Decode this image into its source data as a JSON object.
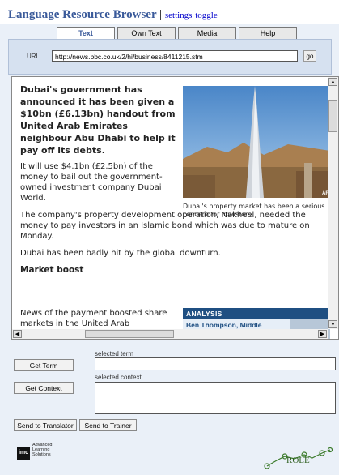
{
  "header": {
    "title": "Language Resource Browser",
    "separator": "|",
    "links": [
      "settings",
      "toggle"
    ]
  },
  "tabs": [
    {
      "label": "Text",
      "active": true
    },
    {
      "label": "Own Text",
      "active": false
    },
    {
      "label": "Media",
      "active": false
    },
    {
      "label": "Help",
      "active": false
    }
  ],
  "url_bar": {
    "label": "URL",
    "value": "http://news.bbc.co.uk/2/hi/business/8411215.stm",
    "go_label": "go"
  },
  "article": {
    "headline": "Dubai's government has announced it has been given a $10bn (£6.13bn) handout from United Arab Emirates neighbour Abu Dhabi to help it pay off its debts.",
    "p1": "It will use $4.1bn (£2.5bn) of the money to bail out the government-owned investment company Dubai World.",
    "p2": "The company's property development operation, Nakheel, needed the money to pay investors in an Islamic bond which was due to mature on Monday.",
    "p3": "Dubai has been badly hit by the global downturn.",
    "subhead": "Market boost",
    "p4": "News of the payment boosted share markets in the United Arab",
    "image_caption": "Dubai's property market has been a serious concern for investors",
    "image_watermark": "AF",
    "analysis_label": "ANALYSIS",
    "analysis_name": "Ben Thompson, Middle"
  },
  "term": {
    "button": "Get Term",
    "label": "selected term",
    "value": ""
  },
  "context": {
    "button": "Get Context",
    "label": "selected context",
    "value": ""
  },
  "actions": {
    "translator": "Send to Translator",
    "trainer": "Send to Trainer"
  },
  "footer": {
    "logo_mark": "imc",
    "logo_text": [
      "Advanced",
      "Learning",
      "Solutions"
    ],
    "roleo_text": "ROLE"
  }
}
